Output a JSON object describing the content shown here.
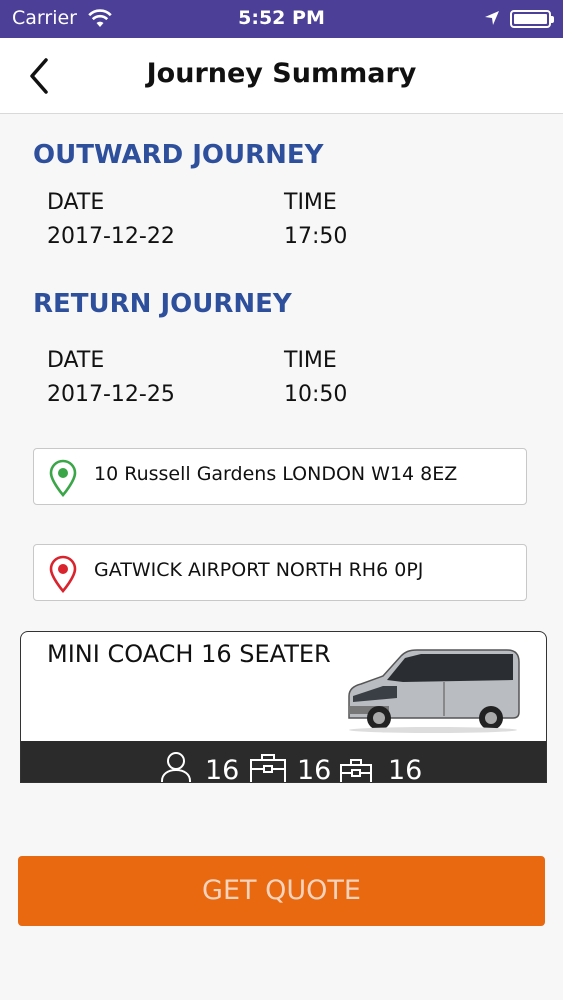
{
  "status_bar": {
    "carrier": "Carrier",
    "time": "5:52 PM"
  },
  "nav": {
    "title": "Journey Summary",
    "back_icon": "chevron-left-icon"
  },
  "outward": {
    "heading": "OUTWARD JOURNEY",
    "date_label": "DATE",
    "date": "2017-12-22",
    "time_label": "TIME",
    "time": "17:50"
  },
  "return": {
    "heading": "RETURN JOURNEY",
    "date_label": "DATE",
    "date": "2017-12-25",
    "time_label": "TIME",
    "time": "10:50"
  },
  "pickup": {
    "address": "10 Russell Gardens LONDON W14 8EZ",
    "icon": "green-location-pin-icon",
    "color": "#3aa648"
  },
  "dropoff": {
    "address": "GATWICK AIRPORT NORTH RH6 0PJ",
    "icon": "red-location-pin-icon",
    "color": "#d9232d"
  },
  "vehicle": {
    "name": "MINI COACH 16 SEATER",
    "passengers": "16",
    "large_luggage": "16",
    "small_luggage": "16"
  },
  "actions": {
    "get_quote": "GET QUOTE"
  },
  "colors": {
    "status_bar": "#4b3f97",
    "heading": "#2d4f9c",
    "button": "#e8690f"
  }
}
